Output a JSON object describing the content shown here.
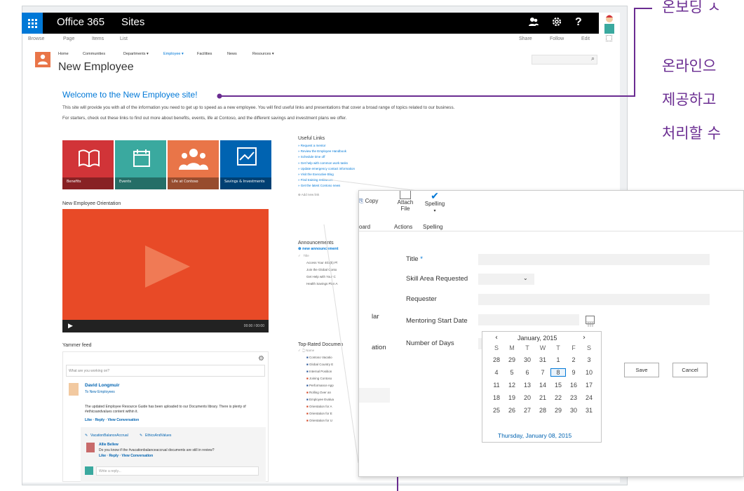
{
  "suite": {
    "brand": "Office 365",
    "app": "Sites",
    "help": "?"
  },
  "ribbon": {
    "tabs": [
      "Browse",
      "Page",
      "Items",
      "List"
    ],
    "actions": [
      "Share",
      "Follow",
      "Edit"
    ]
  },
  "site": {
    "nav": [
      "Home",
      "Communities",
      "Departments ▾",
      "Employee ▾",
      "Facilities",
      "News",
      "Resources ▾"
    ],
    "title": "New Employee"
  },
  "main": {
    "welcome": "Welcome to the New Employee site!",
    "intro": "This site will provide you with all of the information you need to get up to speed as a new employee. You will find useful links and presentations that cover a broad range of topics related to our business. For starters, check out these links to find out more about benefits, events, life at Contoso, and the different savings and investment plans we offer.",
    "tiles": [
      {
        "label": "Benefits",
        "color": "#d13438"
      },
      {
        "label": "Events",
        "color": "#3aa99f"
      },
      {
        "label": "Life at Contoso",
        "color": "#e97548"
      },
      {
        "label": "Savings & Investments",
        "color": "#0063b1"
      }
    ],
    "orientation_label": "New Employee Orientation",
    "video_time": "00:00 / 00:00",
    "yammer_label": "Yammer feed",
    "yammer_prompt": "What are you working on?",
    "post1_author": "David Longmuir",
    "post1_to": "To New Employees",
    "post1_text": "The updated Employee Resource Guide has been uploaded to our Documents library. There is plenty of #ethicsandvalues content within it.",
    "post1_actions": "Like · Reply · View Conversation",
    "tag1": "VacationBalanceAccrual",
    "tag2": "EthicsAndValues",
    "post2_author": "Allie Bellew",
    "post2_text": "Do you know if the #vacationbalanceaccrual documents are still in review?",
    "post2_actions": "Like · Reply · View Conversation",
    "reply_placeholder": "Write a reply..."
  },
  "useful_links": {
    "title": "Useful Links",
    "items": [
      "Request a mentor",
      "Review the Employee Handbook",
      "Schedule time off",
      "Get help with common work tasks",
      "Update emergency contact information",
      "Visit the Executive Blog",
      "Find training resources",
      "Get the latest Contoso news"
    ],
    "add": "Add new link"
  },
  "announcements": {
    "title": "Announcements",
    "new": "new announcement",
    "col": "Title",
    "items": [
      "Access Your 401(k) Pl",
      "Join the Global Conto",
      "Get Help with Your C",
      "Health Savings Plan A"
    ]
  },
  "documents": {
    "title": "Top-Rated Documen",
    "col": "Name",
    "items": [
      "Contoso Vacatio",
      "Global Country E",
      "Internal Position",
      "Joining Contoso",
      "Performance App",
      "Rolling Over an",
      "Employee Evalua",
      "Orientation for A",
      "Orientation for E",
      "Orientation for U"
    ]
  },
  "form": {
    "ribbon": [
      "Copy",
      "Attach File",
      "Spelling"
    ],
    "groups": [
      "oard",
      "Actions",
      "Spelling"
    ],
    "title_label": "Title",
    "required": "*",
    "skill_label": "Skill Area Requested",
    "requester_label": "Requester",
    "start_label": "Mentoring Start Date",
    "days_label": "Number of Days",
    "side1": "lar",
    "side2": "ation",
    "save": "Save",
    "cancel": "Cancel"
  },
  "calendar": {
    "month": "January, 2015",
    "weekdays": [
      "S",
      "M",
      "T",
      "W",
      "T",
      "F",
      "S"
    ],
    "weeks": [
      [
        "28",
        "29",
        "30",
        "31",
        "1",
        "2",
        "3"
      ],
      [
        "4",
        "5",
        "6",
        "7",
        "8",
        "9",
        "10"
      ],
      [
        "11",
        "12",
        "13",
        "14",
        "15",
        "16",
        "17"
      ],
      [
        "18",
        "19",
        "20",
        "21",
        "22",
        "23",
        "24"
      ],
      [
        "25",
        "26",
        "27",
        "28",
        "29",
        "30",
        "31"
      ]
    ],
    "selected": "8",
    "today": "Thursday, January 08, 2015"
  },
  "korean": [
    "온보딩 ㅅ",
    "온라인으",
    "제공하고",
    "처리할 수"
  ],
  "colors": {
    "accent": "#0078d7",
    "purple": "#6a2c91",
    "orange": "#e84a27"
  }
}
